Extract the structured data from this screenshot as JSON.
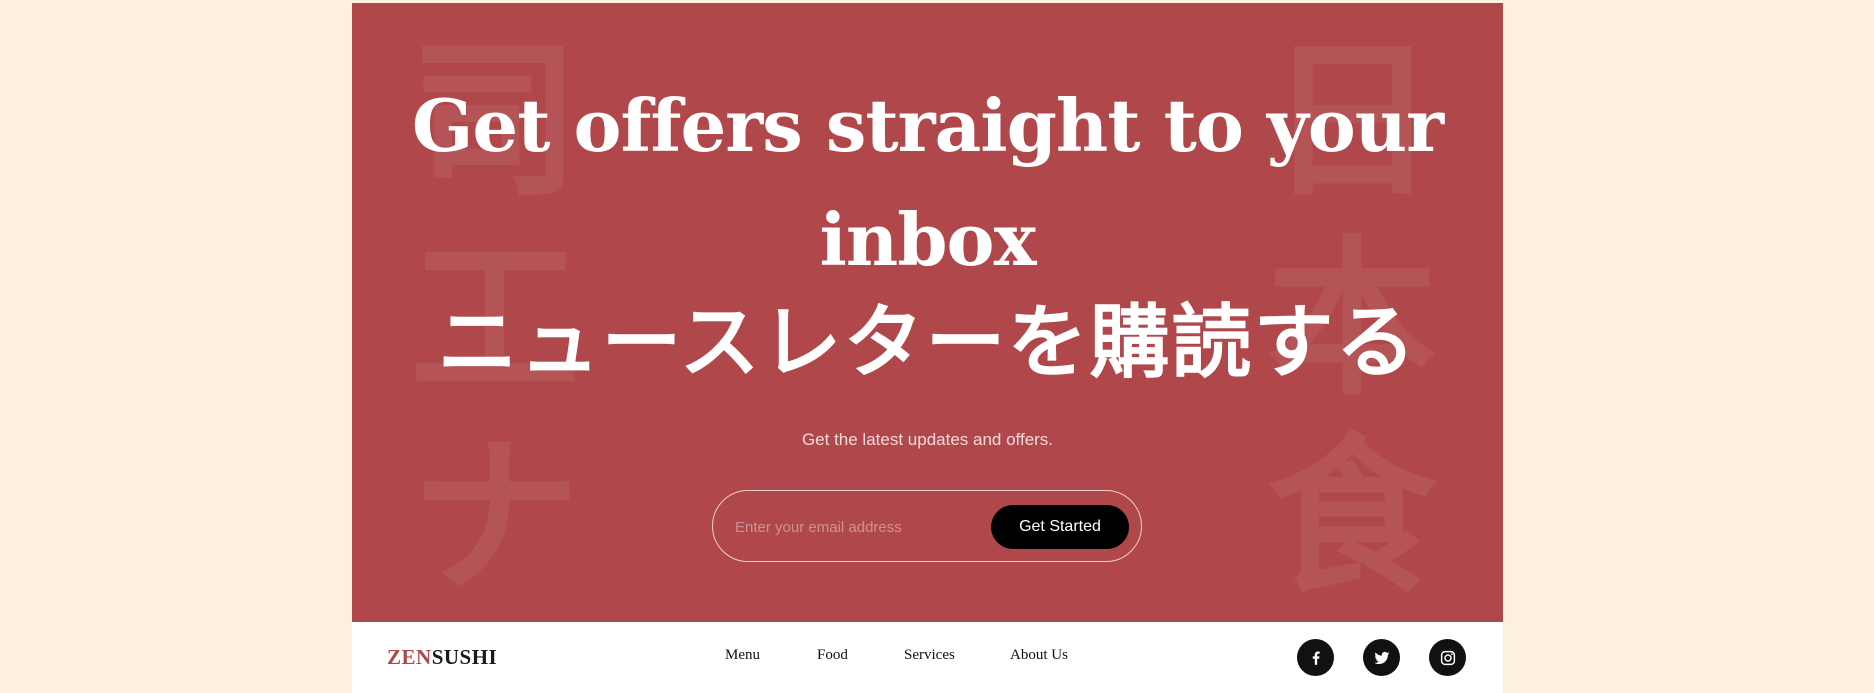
{
  "hero": {
    "decor_left": [
      "司",
      "工",
      "ナ"
    ],
    "decor_right": [
      "日",
      "本",
      "食"
    ],
    "headline_line1": "Get offers straight to your",
    "headline_line2": "inbox",
    "japanese_title": "ニュースレターを購読する",
    "subtitle": "Get the latest updates and offers.",
    "email_placeholder": "Enter your email address",
    "cta_label": "Get Started"
  },
  "footer": {
    "logo_accent": "ZEN",
    "logo_rest": "SUSHI",
    "nav": [
      "Menu",
      "Food",
      "Services",
      "About Us"
    ],
    "social": [
      "facebook-icon",
      "twitter-icon",
      "instagram-icon"
    ]
  },
  "colors": {
    "page_background": "#fdf0df",
    "hero_background": "#b0474b",
    "logo_accent": "#b0474b",
    "button": "#000000"
  }
}
